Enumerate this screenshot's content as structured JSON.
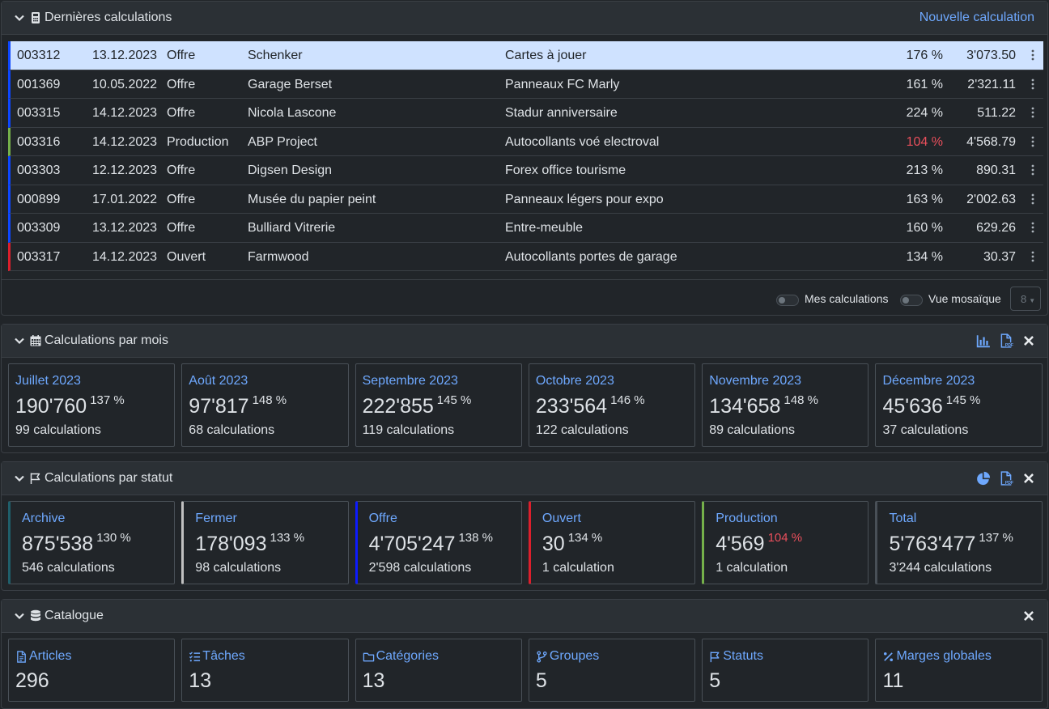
{
  "latest": {
    "title": "Dernières calculations",
    "new_link": "Nouvelle calculation",
    "rows": [
      {
        "id": "003312",
        "date": "13.12.2023",
        "state": "Offre",
        "customer": "Schenker",
        "description": "Cartes à jouer",
        "margin": "176 %",
        "total": "3'073.50",
        "color": "#0d47ff",
        "selected": true,
        "low": false
      },
      {
        "id": "001369",
        "date": "10.05.2022",
        "state": "Offre",
        "customer": "Garage Berset",
        "description": "Panneaux FC Marly",
        "margin": "161 %",
        "total": "2'321.11",
        "color": "#0d47ff",
        "selected": false,
        "low": false
      },
      {
        "id": "003315",
        "date": "14.12.2023",
        "state": "Offre",
        "customer": "Nicola Lascone",
        "description": "Stadur anniversaire",
        "margin": "224 %",
        "total": "511.22",
        "color": "#0d47ff",
        "selected": false,
        "low": false
      },
      {
        "id": "003316",
        "date": "14.12.2023",
        "state": "Production",
        "customer": "ABP Project",
        "description": "Autocollants voé electroval",
        "margin": "104 %",
        "total": "4'568.79",
        "color": "#75b04a",
        "selected": false,
        "low": true
      },
      {
        "id": "003303",
        "date": "12.12.2023",
        "state": "Offre",
        "customer": "Digsen Design",
        "description": "Forex office tourisme",
        "margin": "213 %",
        "total": "890.31",
        "color": "#0d47ff",
        "selected": false,
        "low": false
      },
      {
        "id": "000899",
        "date": "17.01.2022",
        "state": "Offre",
        "customer": "Musée du papier peint",
        "description": "Panneaux légers pour expo",
        "margin": "163 %",
        "total": "2'002.63",
        "color": "#0d47ff",
        "selected": false,
        "low": false
      },
      {
        "id": "003309",
        "date": "13.12.2023",
        "state": "Offre",
        "customer": "Bulliard Vitrerie",
        "description": "Entre-meuble",
        "margin": "160 %",
        "total": "629.26",
        "color": "#0d47ff",
        "selected": false,
        "low": false
      },
      {
        "id": "003317",
        "date": "14.12.2023",
        "state": "Ouvert",
        "customer": "Farmwood",
        "description": "Autocollants portes de garage",
        "margin": "134 %",
        "total": "30.37",
        "color": "#dc1f2c",
        "selected": false,
        "low": false
      }
    ],
    "toggle_mine": "Mes calculations",
    "toggle_mosaic": "Vue mosaïque",
    "page_size": "8"
  },
  "months": {
    "title": "Calculations par mois",
    "tiles": [
      {
        "label": "Juillet 2023",
        "amount": "190'760",
        "margin": "137 %",
        "count": "99 calculations"
      },
      {
        "label": "Août 2023",
        "amount": "97'817",
        "margin": "148 %",
        "count": "68 calculations"
      },
      {
        "label": "Septembre 2023",
        "amount": "222'855",
        "margin": "145 %",
        "count": "119 calculations"
      },
      {
        "label": "Octobre 2023",
        "amount": "233'564",
        "margin": "146 %",
        "count": "122 calculations"
      },
      {
        "label": "Novembre 2023",
        "amount": "134'658",
        "margin": "148 %",
        "count": "89 calculations"
      },
      {
        "label": "Décembre 2023",
        "amount": "45'636",
        "margin": "145 %",
        "count": "37 calculations"
      }
    ]
  },
  "states": {
    "title": "Calculations par statut",
    "tiles": [
      {
        "label": "Archive",
        "amount": "875'538",
        "margin": "130 %",
        "count": "546 calculations",
        "color": "#1f5f6b",
        "low": false
      },
      {
        "label": "Fermer",
        "amount": "178'093",
        "margin": "133 %",
        "count": "98 calculations",
        "color": "#c0c0c0",
        "low": false
      },
      {
        "label": "Offre",
        "amount": "4'705'247",
        "margin": "138 %",
        "count": "2'598 calculations",
        "color": "#0d1bff",
        "low": false
      },
      {
        "label": "Ouvert",
        "amount": "30",
        "margin": "134 %",
        "count": "1 calculation",
        "color": "#dc1f2c",
        "low": false
      },
      {
        "label": "Production",
        "amount": "4'569",
        "margin": "104 %",
        "count": "1 calculation",
        "color": "#75b04a",
        "low": true
      },
      {
        "label": "Total",
        "amount": "5'763'477",
        "margin": "137 %",
        "count": "3'244 calculations",
        "color": "#495057",
        "low": false
      }
    ]
  },
  "catalog": {
    "title": "Catalogue",
    "tiles": [
      {
        "label": "Articles",
        "value": "296",
        "icon": "file-icon"
      },
      {
        "label": "Tâches",
        "value": "13",
        "icon": "task-list-icon"
      },
      {
        "label": "Catégories",
        "value": "13",
        "icon": "folder-icon"
      },
      {
        "label": "Groupes",
        "value": "5",
        "icon": "code-branch-icon"
      },
      {
        "label": "Statuts",
        "value": "5",
        "icon": "flag-icon"
      },
      {
        "label": "Marges globales",
        "value": "11",
        "icon": "percent-icon"
      }
    ]
  },
  "colors": {
    "accent": "#6ea8fe",
    "background": "#212529",
    "header": "#2b3035",
    "danger": "#ea4f5c"
  }
}
